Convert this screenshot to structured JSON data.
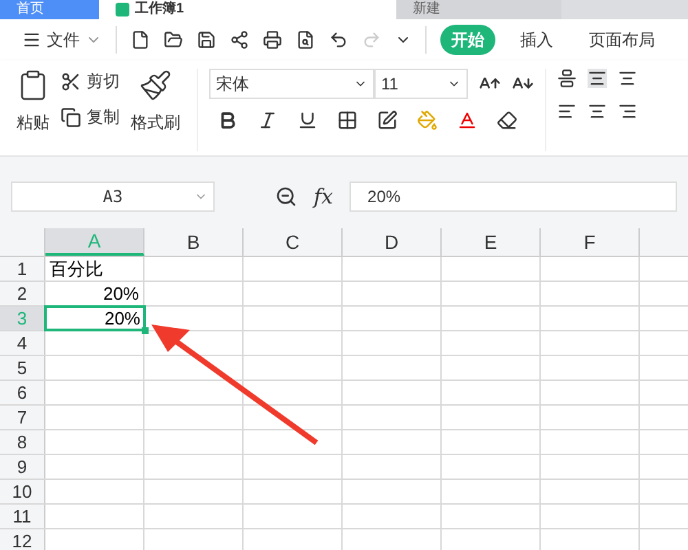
{
  "tabs": [
    {
      "label": "首页",
      "kind": "home",
      "selected": false
    },
    {
      "label": "工作簿1",
      "kind": "doc",
      "selected": true
    },
    {
      "label": "新建",
      "kind": "new",
      "selected": false
    }
  ],
  "file_menu": "文件",
  "ribbon_tabs": [
    {
      "label": "开始",
      "selected": true
    },
    {
      "label": "插入",
      "selected": false
    },
    {
      "label": "页面布局",
      "selected": false
    }
  ],
  "clipboard": {
    "paste": "粘贴",
    "cut": "剪切",
    "copy": "复制",
    "format_painter": "格式刷"
  },
  "font": {
    "name": "宋体",
    "size": "11"
  },
  "name_box": "A3",
  "formula_bar": {
    "fx": "fx",
    "value": "20%"
  },
  "columns": [
    {
      "label": "A",
      "selected": true
    },
    {
      "label": "B",
      "selected": false
    },
    {
      "label": "C",
      "selected": false
    },
    {
      "label": "D",
      "selected": false
    },
    {
      "label": "E",
      "selected": false
    },
    {
      "label": "F",
      "selected": false
    }
  ],
  "rows": [
    {
      "label": "1",
      "selected": false,
      "cells": [
        {
          "text": "百分比",
          "kind": "text",
          "selected": false
        }
      ]
    },
    {
      "label": "2",
      "selected": false,
      "cells": [
        {
          "text": "20%",
          "kind": "number",
          "selected": false
        }
      ]
    },
    {
      "label": "3",
      "selected": true,
      "cells": [
        {
          "text": "20%",
          "kind": "number",
          "selected": true
        }
      ]
    },
    {
      "label": "4",
      "selected": false
    },
    {
      "label": "5",
      "selected": false
    },
    {
      "label": "6",
      "selected": false
    },
    {
      "label": "7",
      "selected": false
    },
    {
      "label": "8",
      "selected": false
    },
    {
      "label": "9",
      "selected": false
    },
    {
      "label": "10",
      "selected": false
    },
    {
      "label": "11",
      "selected": false
    },
    {
      "label": "12",
      "selected": false
    }
  ]
}
